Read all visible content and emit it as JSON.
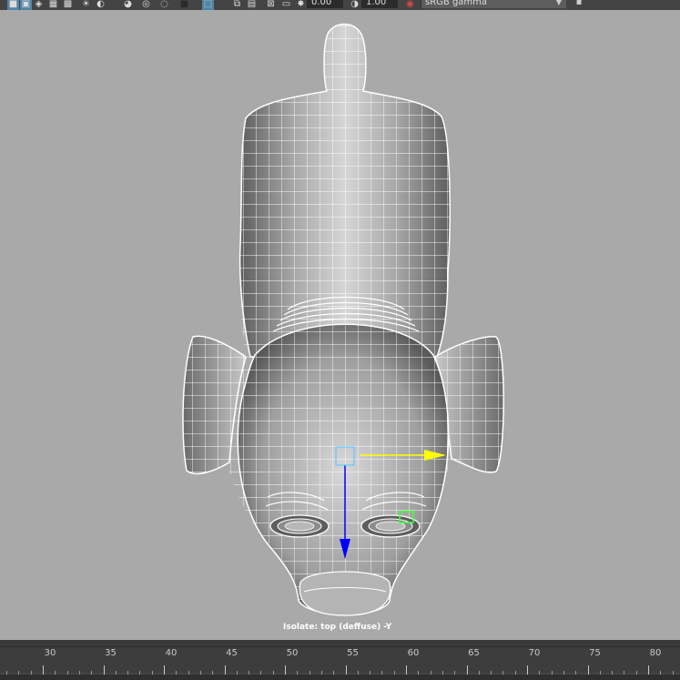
{
  "toolbar": {
    "icons": [
      "isolate-select-icon",
      "xray-joints-icon",
      "xray-icon",
      "textures-icon",
      "lighting-icon",
      "shadows-icon",
      "ambient-occlusion-icon",
      "motion-blur-icon",
      "antialias-icon",
      "depth-of-field-icon",
      "gate-mask-icon",
      "resolution-gate-icon",
      "safe-action-icon",
      "field-chart-icon",
      "film-gate-icon",
      "exposure-icon",
      "gamma-icon"
    ],
    "exposure_value": "0.00",
    "gamma_value": "1.00",
    "color_space": "sRGB gamma"
  },
  "viewport": {
    "hud_label": "Isolate: top (deffuse) -Y",
    "manipulator": {
      "x_axis_color": "#ffff00",
      "y_axis_color": "#0000ff",
      "center_color": "#5fc8ff",
      "selected_component_color": "#3dff3d"
    },
    "mesh_color": "#ffffff",
    "shading_dark": "#5a5a5a",
    "shading_light": "#d8d8d8"
  },
  "timeline": {
    "ticks": [
      "30",
      "35",
      "40",
      "45",
      "50",
      "55",
      "60",
      "65",
      "70",
      "75",
      "80"
    ]
  }
}
